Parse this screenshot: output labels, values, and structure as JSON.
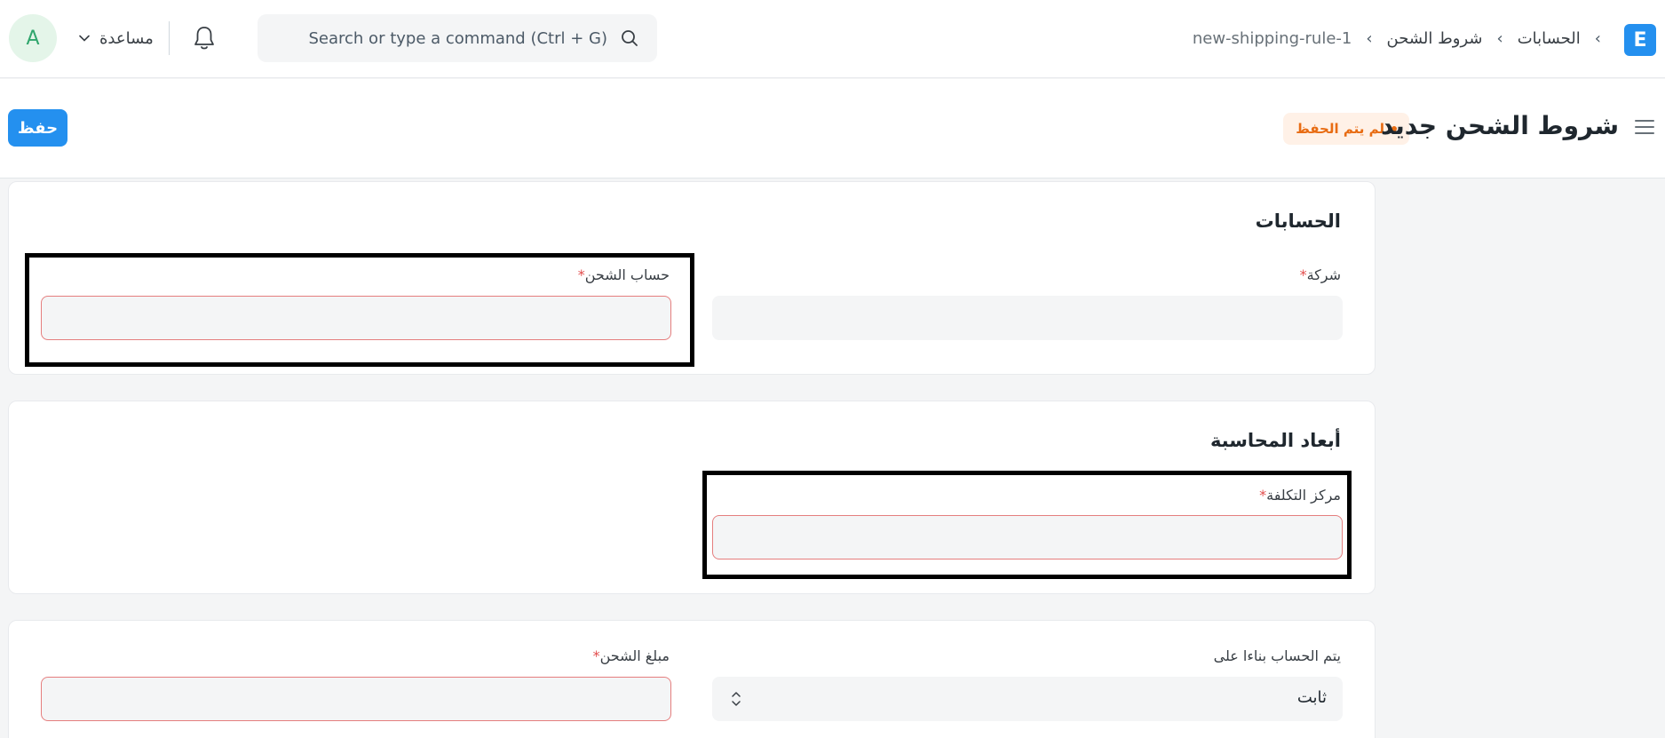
{
  "navbar": {
    "avatar_initial": "A",
    "help_label": "مساعدة",
    "search_placeholder": "Search or type a command (Ctrl + G)",
    "breadcrumbs": [
      "الحسابات",
      "شروط الشحن",
      "new-shipping-rule-1"
    ],
    "logo_letter": "E",
    "icons": [
      "bell-icon",
      "search-icon",
      "chevron-down-icon",
      "chevron-left-icon"
    ]
  },
  "page": {
    "title": "شروط الشحن جديد",
    "status": "لم يتم الحفظ",
    "save_label": "حفظ",
    "colors": {
      "primary": "#2490ef",
      "warning": "#e86c13",
      "danger": "#e24c4c"
    }
  },
  "sections": {
    "accounts": {
      "title": "الحسابات",
      "company_label": "شركة",
      "company_value": "",
      "shipping_account_label": "حساب الشحن",
      "shipping_account_value": ""
    },
    "dimensions": {
      "title": "أبعاد المحاسبة",
      "cost_center_label": "مركز التكلفة",
      "cost_center_value": ""
    },
    "calc": {
      "calculate_based_on_label": "يتم الحساب بناءا على",
      "calculate_based_on_value": "ثابت",
      "shipping_amount_label": "مبلغ الشحن",
      "shipping_amount_value": ""
    },
    "required_marker": "*"
  }
}
